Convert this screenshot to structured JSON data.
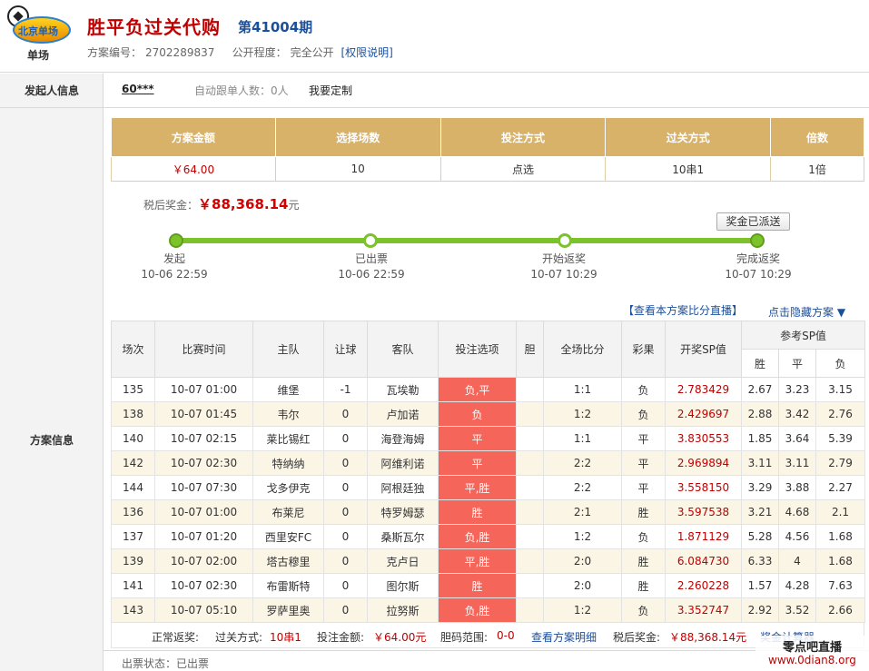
{
  "header": {
    "logo_text": "单场",
    "logo_badge": "北京单场",
    "title": "胜平负过关代购",
    "issue": "第41004期",
    "plan_no_label": "方案编号：",
    "plan_no": "2702289837",
    "public_label": "公开程度：",
    "public_value": "完全公开",
    "permission_link": "[权限说明]"
  },
  "initiator": {
    "label": "发起人信息",
    "name": "60***",
    "follow": "自动跟单人数：0人",
    "custom": "我要定制"
  },
  "plan_label": "方案信息",
  "summary": {
    "headers": [
      "方案金额",
      "选择场数",
      "投注方式",
      "过关方式",
      "倍数"
    ],
    "values": [
      "￥64.00",
      "10",
      "点选",
      "10串1",
      "1倍"
    ]
  },
  "prize": {
    "label": "税后奖金：",
    "amount": "￥88,368.14",
    "unit": "元"
  },
  "progress": {
    "sent_button": "奖金已派送",
    "steps": [
      {
        "name": "发起",
        "time": "10-06 22:59"
      },
      {
        "name": "已出票",
        "time": "10-06 22:59"
      },
      {
        "name": "开始返奖",
        "time": "10-07 10:29"
      },
      {
        "name": "完成返奖",
        "time": "10-07 10:29"
      }
    ]
  },
  "links": {
    "live": "【查看本方案比分直播】",
    "hide": "点击隐藏方案 ▼"
  },
  "detail": {
    "headers": [
      "场次",
      "比赛时间",
      "主队",
      "让球",
      "客队",
      "投注选项",
      "胆",
      "全场比分",
      "彩果",
      "开奖SP值",
      "参考SP值"
    ],
    "sp_sub": [
      "胜",
      "平",
      "负"
    ],
    "rows": [
      [
        "135",
        "10-07 01:00",
        "维堡",
        "-1",
        "瓦埃勒",
        "负,平",
        "",
        "1:1",
        "负",
        "2.783429",
        "2.67",
        "3.23",
        "3.15"
      ],
      [
        "138",
        "10-07 01:45",
        "韦尔",
        "0",
        "卢加诺",
        "负",
        "",
        "1:2",
        "负",
        "2.429697",
        "2.88",
        "3.42",
        "2.76"
      ],
      [
        "140",
        "10-07 02:15",
        "莱比锡红",
        "0",
        "海登海姆",
        "平",
        "",
        "1:1",
        "平",
        "3.830553",
        "1.85",
        "3.64",
        "5.39"
      ],
      [
        "142",
        "10-07 02:30",
        "特纳纳",
        "0",
        "阿维利诺",
        "平",
        "",
        "2:2",
        "平",
        "2.969894",
        "3.11",
        "3.11",
        "2.79"
      ],
      [
        "144",
        "10-07 07:30",
        "戈多伊克",
        "0",
        "阿根廷独",
        "平,胜",
        "",
        "2:2",
        "平",
        "3.558150",
        "3.29",
        "3.88",
        "2.27"
      ],
      [
        "136",
        "10-07 01:00",
        "布莱尼",
        "0",
        "特罗姆瑟",
        "胜",
        "",
        "2:1",
        "胜",
        "3.597538",
        "3.21",
        "4.68",
        "2.1"
      ],
      [
        "137",
        "10-07 01:20",
        "西里安FC",
        "0",
        "桑斯瓦尔",
        "负,胜",
        "",
        "1:2",
        "负",
        "1.871129",
        "5.28",
        "4.56",
        "1.68"
      ],
      [
        "139",
        "10-07 02:00",
        "塔古穆里",
        "0",
        "克卢日",
        "平,胜",
        "",
        "2:0",
        "胜",
        "6.084730",
        "6.33",
        "4",
        "1.68"
      ],
      [
        "141",
        "10-07 02:30",
        "布雷斯特",
        "0",
        "图尔斯",
        "胜",
        "",
        "2:0",
        "胜",
        "2.260228",
        "1.57",
        "4.28",
        "7.63"
      ],
      [
        "143",
        "10-07 05:10",
        "罗萨里奥",
        "0",
        "拉努斯",
        "负,胜",
        "",
        "1:2",
        "负",
        "3.352747",
        "2.92",
        "3.52",
        "2.66"
      ]
    ]
  },
  "footer": {
    "normal": "正常返奖:",
    "pass_label": "过关方式:",
    "pass_value": "10串1",
    "bet_label": "投注金额:",
    "bet_value": "￥64.00元",
    "range_label": "胆码范围:",
    "range_value": "0-0",
    "detail_link": "查看方案明细",
    "prize_label": "税后奖金:",
    "prize_value": "￥88,368.14元",
    "calc": "奖金计算器"
  },
  "ticket_status": "出票状态：已出票",
  "watermark": {
    "line1": "零点吧直播",
    "line2": "www.0dian8.org"
  }
}
